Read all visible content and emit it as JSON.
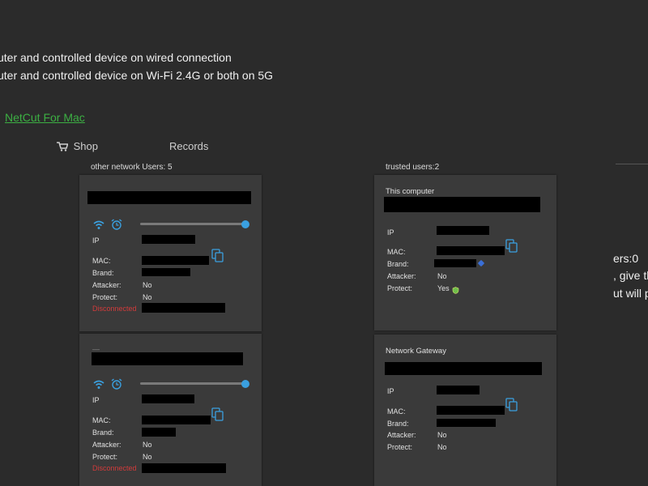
{
  "instructions": {
    "line1": "uter and controlled device on wired connection",
    "line2": "uter and controlled device on Wi-Fi 2.4G or both on 5G"
  },
  "links": {
    "netcut_mac": "NetCut For Mac"
  },
  "nav": {
    "shop": "Shop",
    "records": "Records"
  },
  "other_users": {
    "header": "other network Users: 5",
    "cards": [
      {
        "slider_fraction": 1.0,
        "labels": {
          "ip": "IP",
          "mac": "MAC:",
          "brand": "Brand:",
          "attacker": "Attacker:",
          "protect": "Protect:",
          "status": "Disconnected"
        },
        "attacker": "No",
        "protect": "No"
      },
      {
        "top_label": "—",
        "slider_fraction": 1.0,
        "labels": {
          "ip": "IP",
          "mac": "MAC:",
          "brand": "Brand:",
          "attacker": "Attacker:",
          "protect": "Protect:",
          "status": "Disconnected"
        },
        "attacker": "No",
        "protect": "No"
      }
    ]
  },
  "trusted_users": {
    "header": "trusted users:2",
    "cards": [
      {
        "title": "This computer",
        "labels": {
          "ip": "IP",
          "mac": "MAC:",
          "brand": "Brand:",
          "attacker": "Attacker:",
          "protect": "Protect:"
        },
        "attacker": "No",
        "protect": "Yes"
      },
      {
        "title": "Network Gateway",
        "labels": {
          "ip": "IP",
          "mac": "MAC:",
          "brand": "Brand:",
          "attacker": "Attacker:",
          "protect": "Protect:"
        },
        "attacker": "No",
        "protect": "No"
      }
    ]
  },
  "side_text": {
    "line1": "ers:0",
    "line2": ", give th",
    "line3": "ut will p"
  },
  "colors": {
    "accent": "#3aa0e0",
    "link": "#3cb043",
    "disconnected": "#d23b3b",
    "background": "#2b2b2b",
    "card": "#3a3a3a"
  }
}
